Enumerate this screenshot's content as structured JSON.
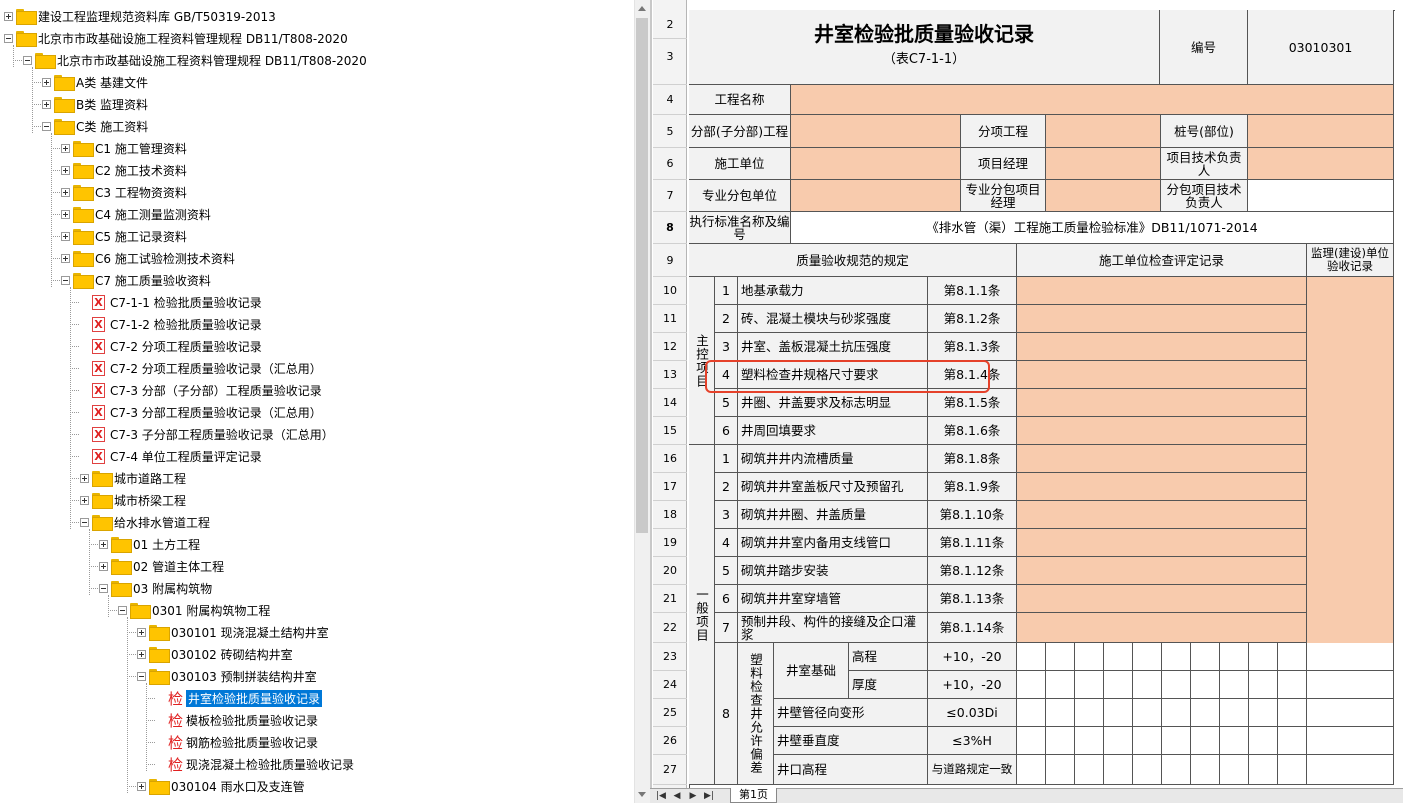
{
  "tree": {
    "items": [
      {
        "label": "建设工程监理规范资料库 GB/T50319-2013",
        "level": 0,
        "type": "folder",
        "expander": "plus"
      },
      {
        "label": "北京市市政基础设施工程资料管理规程 DB11/T808-2020",
        "level": 0,
        "type": "folder",
        "expander": "minus"
      },
      {
        "label": "北京市市政基础设施工程资料管理规程 DB11/T808-2020",
        "level": 1,
        "type": "folder",
        "expander": "minus"
      },
      {
        "label": "A类 基建文件",
        "level": 2,
        "type": "folder",
        "expander": "plus"
      },
      {
        "label": "B类 监理资料",
        "level": 2,
        "type": "folder",
        "expander": "plus"
      },
      {
        "label": "C类 施工资料",
        "level": 2,
        "type": "folder",
        "expander": "minus"
      },
      {
        "label": "C1 施工管理资料",
        "level": 3,
        "type": "folder",
        "expander": "plus"
      },
      {
        "label": "C2 施工技术资料",
        "level": 3,
        "type": "folder",
        "expander": "plus"
      },
      {
        "label": "C3 工程物资资料",
        "level": 3,
        "type": "folder",
        "expander": "plus"
      },
      {
        "label": "C4 施工测量监测资料",
        "level": 3,
        "type": "folder",
        "expander": "plus"
      },
      {
        "label": "C5 施工记录资料",
        "level": 3,
        "type": "folder",
        "expander": "plus"
      },
      {
        "label": "C6 施工试验检测技术资料",
        "level": 3,
        "type": "folder",
        "expander": "plus"
      },
      {
        "label": "C7 施工质量验收资料",
        "level": 3,
        "type": "folder",
        "expander": "minus"
      },
      {
        "label": "C7-1-1 检验批质量验收记录",
        "level": 4,
        "type": "xdoc"
      },
      {
        "label": "C7-1-2 检验批质量验收记录",
        "level": 4,
        "type": "xdoc"
      },
      {
        "label": "C7-2 分项工程质量验收记录",
        "level": 4,
        "type": "xdoc"
      },
      {
        "label": "C7-2 分项工程质量验收记录（汇总用）",
        "level": 4,
        "type": "xdoc"
      },
      {
        "label": "C7-3 分部（子分部）工程质量验收记录",
        "level": 4,
        "type": "xdoc"
      },
      {
        "label": "C7-3 分部工程质量验收记录（汇总用）",
        "level": 4,
        "type": "xdoc"
      },
      {
        "label": "C7-3 子分部工程质量验收记录（汇总用）",
        "level": 4,
        "type": "xdoc"
      },
      {
        "label": "C7-4 单位工程质量评定记录",
        "level": 4,
        "type": "xdoc"
      },
      {
        "label": "城市道路工程",
        "level": 4,
        "type": "folder",
        "expander": "plus"
      },
      {
        "label": "城市桥梁工程",
        "level": 4,
        "type": "folder",
        "expander": "plus"
      },
      {
        "label": "给水排水管道工程",
        "level": 4,
        "type": "folder",
        "expander": "minus"
      },
      {
        "label": "01 土方工程",
        "level": 5,
        "type": "folder",
        "expander": "plus"
      },
      {
        "label": "02 管道主体工程",
        "level": 5,
        "type": "folder",
        "expander": "plus"
      },
      {
        "label": "03 附属构筑物",
        "level": 5,
        "type": "folder",
        "expander": "minus"
      },
      {
        "label": "0301 附属构筑物工程",
        "level": 6,
        "type": "folder",
        "expander": "minus"
      },
      {
        "label": "030101 现浇混凝土结构井室",
        "level": 7,
        "type": "folder",
        "expander": "plus"
      },
      {
        "label": "030102 砖砌结构井室",
        "level": 7,
        "type": "folder",
        "expander": "plus"
      },
      {
        "label": "030103 预制拼装结构井室",
        "level": 7,
        "type": "folder",
        "expander": "minus"
      },
      {
        "label": "井室检验批质量验收记录",
        "level": 8,
        "type": "jian",
        "selected": true
      },
      {
        "label": "模板检验批质量验收记录",
        "level": 8,
        "type": "jian"
      },
      {
        "label": "钢筋检验批质量验收记录",
        "level": 8,
        "type": "jian"
      },
      {
        "label": "现浇混凝土检验批质量验收记录",
        "level": 8,
        "type": "jian"
      },
      {
        "label": "030104 雨水口及支连管",
        "level": 7,
        "type": "folder",
        "expander": "plus"
      }
    ],
    "jian_glyph": "检",
    "xdoc_glyph": "X"
  },
  "sheet": {
    "row_numbers": [
      "2",
      "3",
      "4",
      "5",
      "6",
      "7",
      "8",
      "9",
      "10",
      "11",
      "12",
      "13",
      "14",
      "15",
      "16",
      "17",
      "18",
      "19",
      "20",
      "21",
      "22",
      "23",
      "24",
      "25",
      "26",
      "27"
    ],
    "title": "井室检验批质量验收记录",
    "subtitle": "（表C7-1-1）",
    "code_label": "编号",
    "code_value": "03010301",
    "project_name_label": "工程名称",
    "subunit_label": "分部(子分部)工程",
    "subitem_label": "分项工程",
    "pile_label": "桩号(部位)",
    "construction_unit_label": "施工单位",
    "project_manager_label": "项目经理",
    "tech_lead_label": "项目技术负责人",
    "subcontractor_label": "专业分包单位",
    "sub_pm_label": "专业分包项目经理",
    "sub_tech_label": "分包项目技术负责人",
    "standard_label": "执行标准名称及编号",
    "standard_value": "《排水管（渠）工程施工质量检验标准》DB11/1071-2014",
    "spec_header": "质量验收规范的规定",
    "inspect_header": "施工单位检查评定记录",
    "supervise_header": "监理(建设)单位验收记录",
    "main_group": "主控项目",
    "general_group": "一般项目",
    "main_items": [
      {
        "no": "1",
        "text": "地基承载力",
        "clause": "第8.1.1条"
      },
      {
        "no": "2",
        "text": "砖、混凝土模块与砂浆强度",
        "clause": "第8.1.2条"
      },
      {
        "no": "3",
        "text": "井室、盖板混凝土抗压强度",
        "clause": "第8.1.3条"
      },
      {
        "no": "4",
        "text": "塑料检查井规格尺寸要求",
        "clause": "第8.1.4条"
      },
      {
        "no": "5",
        "text": "井圈、井盖要求及标志明显",
        "clause": "第8.1.5条"
      },
      {
        "no": "6",
        "text": "井周回填要求",
        "clause": "第8.1.6条"
      }
    ],
    "general_items": [
      {
        "no": "1",
        "text": "砌筑井井内流槽质量",
        "clause": "第8.1.8条"
      },
      {
        "no": "2",
        "text": "砌筑井井室盖板尺寸及预留孔",
        "clause": "第8.1.9条"
      },
      {
        "no": "3",
        "text": "砌筑井井圈、井盖质量",
        "clause": "第8.1.10条"
      },
      {
        "no": "4",
        "text": "砌筑井井室内备用支线管口",
        "clause": "第8.1.11条"
      },
      {
        "no": "5",
        "text": "砌筑井踏步安装",
        "clause": "第8.1.12条"
      },
      {
        "no": "6",
        "text": "砌筑井井室穿墙管",
        "clause": "第8.1.13条"
      },
      {
        "no": "7",
        "text": "预制井段、构件的接缝及企口灌浆",
        "clause": "第8.1.14条"
      }
    ],
    "item8_no": "8",
    "item8_group": "塑料检查井允许偏差",
    "well_base_label": "井室基础",
    "height_label": "高程",
    "height_tol": "+10，-20",
    "thick_label": "厚度",
    "thick_tol": "+10，-20",
    "radial_label": "井壁管径向变形",
    "radial_tol": "≤0.03Di",
    "vertical_label": "井壁垂直度",
    "vertical_tol": "≤3%H",
    "mouth_label": "井口高程",
    "mouth_tol": "与道路规定一致",
    "sheet_tab": "第1页"
  },
  "colors": {
    "input_fill": "#f8cbad",
    "header_fill": "#f2f2f2",
    "selection": "#0078d7",
    "highlight": "#e5412a",
    "folder": "#ffc400"
  }
}
